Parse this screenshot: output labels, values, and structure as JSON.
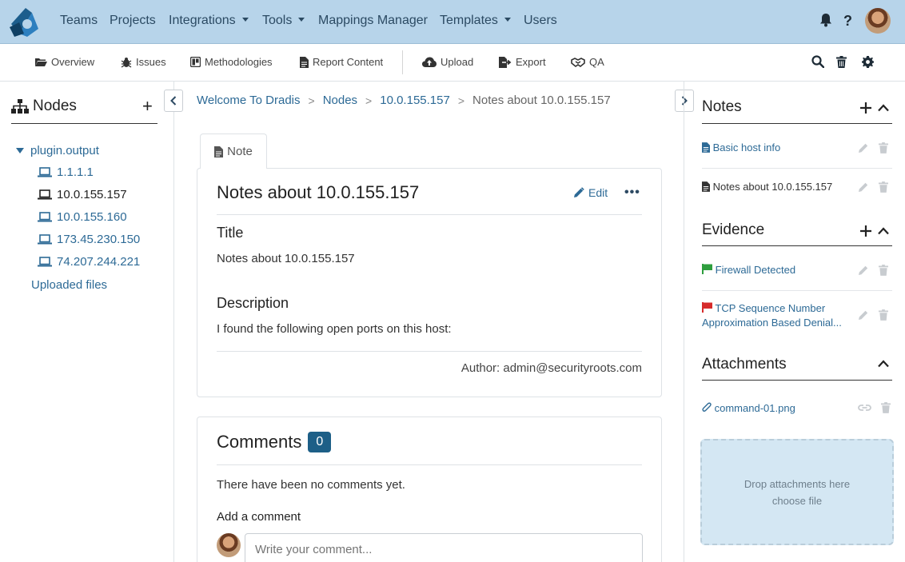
{
  "topnav": {
    "items": [
      {
        "label": "Teams"
      },
      {
        "label": "Projects"
      },
      {
        "label": "Integrations"
      },
      {
        "label": "Tools"
      },
      {
        "label": "Mappings Manager"
      },
      {
        "label": "Templates"
      },
      {
        "label": "Users"
      }
    ],
    "icons": [
      "bell-icon",
      "help-icon",
      "user-avatar"
    ]
  },
  "subnav": {
    "items": [
      {
        "label": "Overview",
        "icon": "folder-open-icon"
      },
      {
        "label": "Issues",
        "icon": "bug-icon"
      },
      {
        "label": "Methodologies",
        "icon": "board-icon"
      },
      {
        "label": "Report Content",
        "icon": "document-icon"
      },
      {
        "label": "Upload",
        "icon": "cloud-upload-icon"
      },
      {
        "label": "Export",
        "icon": "export-icon"
      },
      {
        "label": "QA",
        "icon": "handshake-icon"
      }
    ],
    "tools": [
      "search-icon",
      "trash-icon",
      "gear-icon"
    ]
  },
  "left": {
    "title": "Nodes",
    "add": "+",
    "root": "plugin.output",
    "nodes": [
      "1.1.1.1",
      "10.0.155.157",
      "10.0.155.160",
      "173.45.230.150",
      "74.207.244.221"
    ],
    "uploaded": "Uploaded files"
  },
  "breadcrumb": {
    "items": [
      "Welcome To Dradis",
      "Nodes",
      "10.0.155.157"
    ],
    "current": "Notes about 10.0.155.157",
    "separator": ">"
  },
  "note": {
    "tab": "Note",
    "heading": "Notes about 10.0.155.157",
    "edit": "Edit",
    "more": "•••",
    "title_label": "Title",
    "title_value": "Notes about 10.0.155.157",
    "description_label": "Description",
    "description_value": "I found the following open ports on this host:",
    "author": "Author: admin@securityroots.com"
  },
  "comments": {
    "title": "Comments",
    "count": "0",
    "empty": "There have been no comments yet.",
    "add_label": "Add a comment",
    "placeholder": "Write your comment..."
  },
  "right": {
    "notes_title": "Notes",
    "notes": [
      "Basic host info",
      "Notes about 10.0.155.157"
    ],
    "evidence_title": "Evidence",
    "evidence": [
      {
        "label": "Firewall Detected",
        "flag": "#2e9e3e"
      },
      {
        "label": "TCP Sequence Number Approximation Based Denial...",
        "flag": "#d62b2b"
      }
    ],
    "attachments_title": "Attachments",
    "attachments": [
      "command-01.png"
    ],
    "drop_text": "Drop attachments here",
    "choose_file": "choose file"
  },
  "colors": {
    "navbar": "#b7d4ea",
    "link": "#2d6a96",
    "badge": "#1d5f87",
    "dropzone": "#d4e7f3"
  }
}
